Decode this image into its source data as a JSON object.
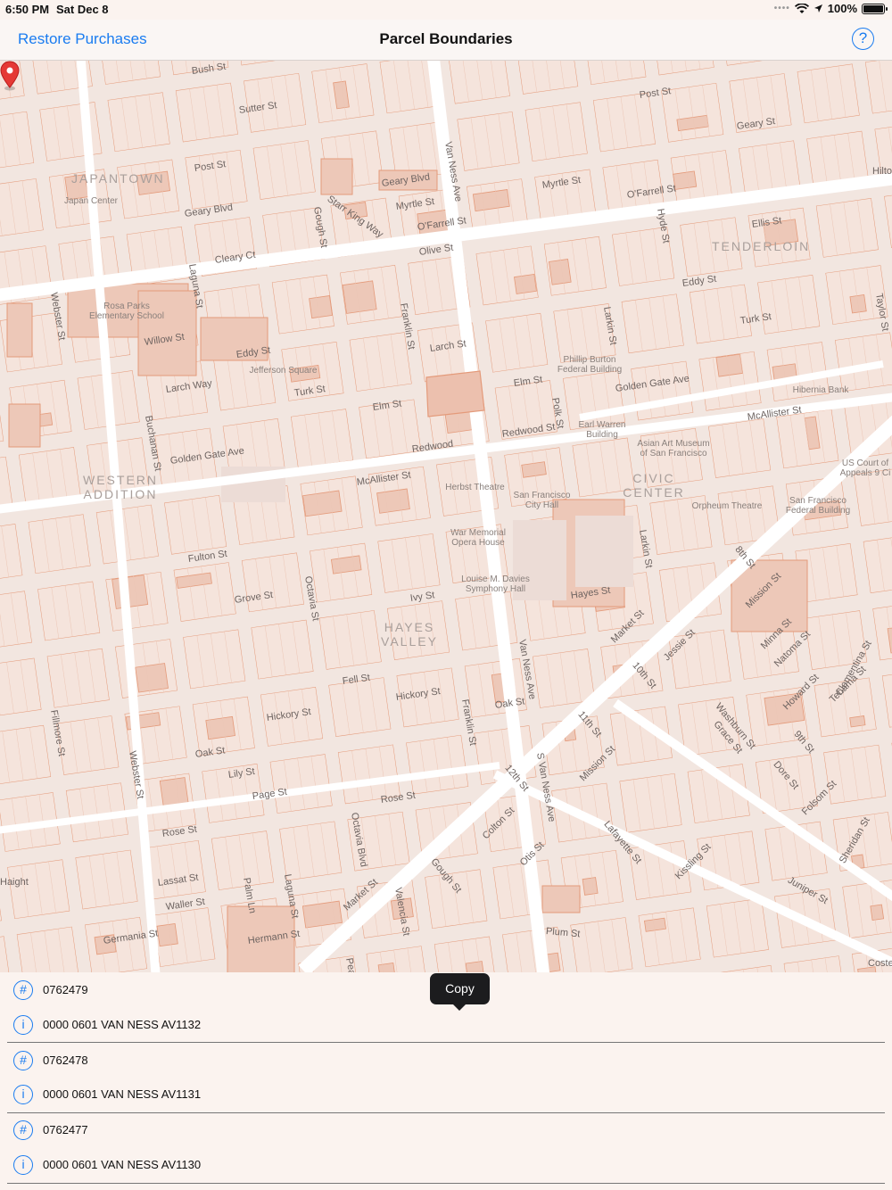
{
  "status": {
    "time": "6:50 PM",
    "date": "Sat Dec 8",
    "battery": "100%"
  },
  "nav": {
    "restore_label": "Restore Purchases",
    "title": "Parcel Boundaries",
    "help_glyph": "?"
  },
  "map": {
    "streets": [
      "Bush St",
      "Sutter St",
      "Post St",
      "Post St",
      "Geary St",
      "Geary Blvd",
      "Geary Blvd",
      "Myrtle St",
      "Myrtle St",
      "O'Farrell St",
      "O'Farrell St",
      "Olive St",
      "Ellis St",
      "Cleary Ct",
      "Eddy St",
      "Eddy St",
      "Willow St",
      "Larch St",
      "Larch Way",
      "Turk St",
      "Turk St",
      "Elm St",
      "Elm St",
      "Golden Gate Ave",
      "Golden Gate Ave",
      "McAllister St",
      "McAllister St",
      "Redwood",
      "Redwood St",
      "Fulton St",
      "Grove St",
      "Ivy St",
      "Hayes St",
      "Fell St",
      "Hickory St",
      "Hickory St",
      "Oak St",
      "Oak St",
      "Lily St",
      "Page St",
      "Rose St",
      "Rose St",
      "Haight",
      "Lassat St",
      "Waller St",
      "Germania St",
      "Hermann St",
      "Market St",
      "Market St",
      "Valencia St",
      "Plum St",
      "Webster St",
      "Webster St",
      "Laguna St",
      "Laguna St",
      "Buchanan St",
      "Fillmore St",
      "Octavia St",
      "Octavia Blvd",
      "Gough St",
      "Gough St",
      "Franklin St",
      "Franklin St",
      "Van Ness Ave",
      "Van Ness Ave",
      "S Van Ness Ave",
      "Polk St",
      "Larkin St",
      "Larkin St",
      "Hyde St",
      "Taylor St",
      "Starr King Way",
      "12th St",
      "11th St",
      "10th St",
      "8th St",
      "9th St",
      "Mission St",
      "Mission St",
      "Jessie St",
      "Minna St",
      "Natoma St",
      "Howard St",
      "Tehama St",
      "Clementina St",
      "Folsom St",
      "Washburn St",
      "Grace St",
      "Dore St",
      "Lafayette St",
      "Kissling St",
      "Juniper St",
      "Sheridan St",
      "Colton St",
      "Otis St",
      "Hilto",
      "Coste",
      "Pearl",
      "Palm Ln"
    ],
    "districts": [
      "JAPANTOWN",
      "TENDERLOIN",
      "WESTERN ADDITION",
      "CIVIC CENTER",
      "HAYES VALLEY"
    ],
    "pois": [
      "Japan Center",
      "Rosa Parks Elementary School",
      "Jefferson Square",
      "Phillip Burton Federal Building",
      "Earl Warren Building",
      "Asian Art Museum of San Francisco",
      "Hibernia Bank",
      "US Court of Appeals 9 Ci",
      "Herbst Theatre",
      "San Francisco City Hall",
      "War Memorial Opera House",
      "Louise M. Davies Symphony Hall",
      "Orpheum Theatre",
      "San Francisco Federal Building"
    ],
    "selected_pin": "map-pin-icon"
  },
  "tooltip": {
    "label": "Copy"
  },
  "parcels": [
    {
      "id_icon": "#",
      "id": "0762479",
      "info_icon": "i",
      "address": "0000 0601 VAN NESS AV1132"
    },
    {
      "id_icon": "#",
      "id": "0762478",
      "info_icon": "i",
      "address": "0000 0601 VAN NESS AV1131"
    },
    {
      "id_icon": "#",
      "id": "0762477",
      "info_icon": "i",
      "address": "0000 0601 VAN NESS AV1130"
    }
  ],
  "colors": {
    "accent": "#1a7cf0",
    "parcel_fill": "#edc8b8",
    "parcel_stroke": "#e49a7a",
    "pin": "#e53935"
  }
}
